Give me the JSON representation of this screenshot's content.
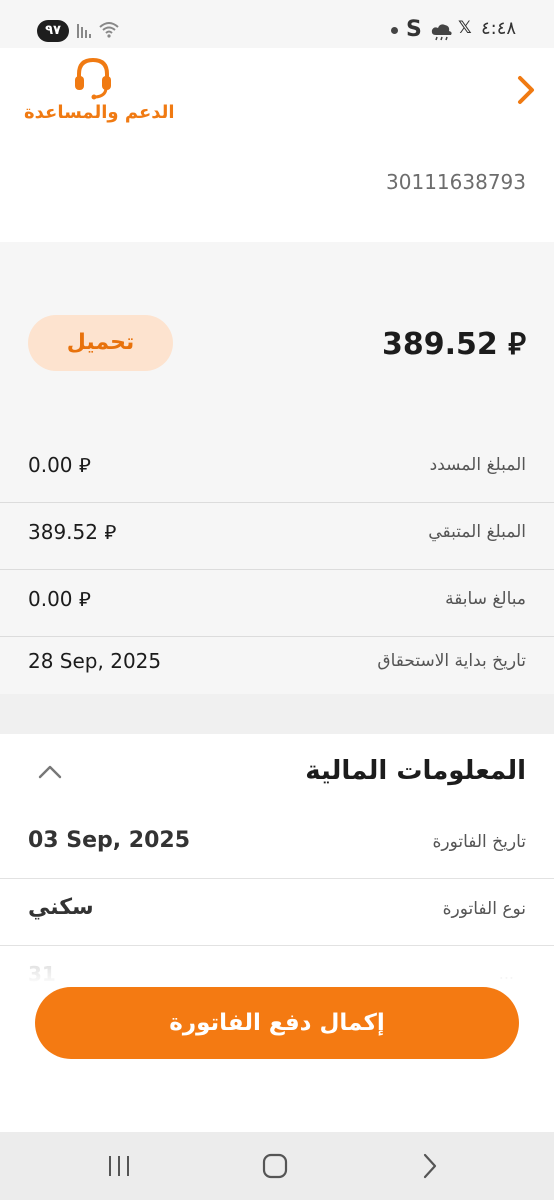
{
  "status_bar": {
    "time": "٤:٤٨",
    "battery": "٩٧",
    "icons": [
      "notification-dot-icon",
      "s-app-icon",
      "weather-cloud-icon",
      "x-app-icon",
      "wifi-icon",
      "signal-icon"
    ]
  },
  "header": {
    "support_label": "الدعم والمساعدة",
    "account_number": "30111638793"
  },
  "summary": {
    "total": "389.52 ⃁",
    "download_label": "تحميل",
    "rows": [
      {
        "label": "المبلغ المسدد",
        "value": "0.00 ⃁"
      },
      {
        "label": "المبلغ المتبقي",
        "value": "389.52 ⃁"
      },
      {
        "label": "مبالغ سابقة",
        "value": "0.00 ⃁"
      },
      {
        "label": "تاريخ بداية الاستحقاق",
        "value": "28 Sep, 2025"
      }
    ]
  },
  "financial_info": {
    "title": "المعلومات المالية",
    "rows": [
      {
        "label": "تاريخ الفاتورة",
        "value": "03 Sep, 2025"
      },
      {
        "label": "نوع الفاتورة",
        "value": "سكني"
      }
    ],
    "partial_row": {
      "label": "...",
      "value": "31"
    }
  },
  "pay_button_label": "إكمال دفع الفاتورة",
  "colors": {
    "accent": "#F47A12",
    "accent_light": "#FDE3CF",
    "background_gray": "#F6F6F6"
  }
}
